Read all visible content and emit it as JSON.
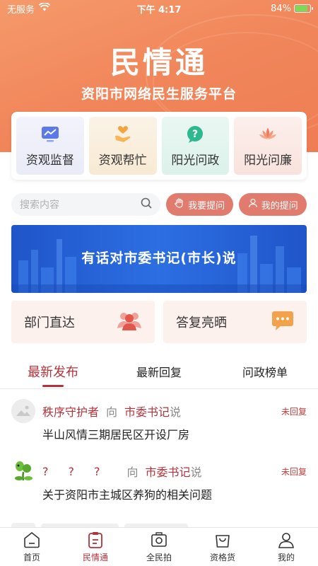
{
  "status_bar": {
    "carrier": "无服务",
    "time": "下午 4:17",
    "battery": "84%",
    "battery_level": 0.84
  },
  "header": {
    "title": "民情通",
    "subtitle": "资阳市网络民生服务平台"
  },
  "quick_entries": [
    {
      "label": "资观监督",
      "icon": "monitor-chart-icon"
    },
    {
      "label": "资观帮忙",
      "icon": "heart-hand-icon"
    },
    {
      "label": "阳光问政",
      "icon": "question-bubble-icon"
    },
    {
      "label": "阳光问廉",
      "icon": "lotus-icon"
    }
  ],
  "search": {
    "placeholder": "搜索内容",
    "ask_button": "我要提问",
    "my_questions_button": "我的提问"
  },
  "banner": {
    "text": "有话对市委书记(市长)说"
  },
  "entries": {
    "department": "部门直达",
    "replies": "答复亮晒"
  },
  "tabs": [
    {
      "label": "最新发布",
      "active": true
    },
    {
      "label": "最新回复",
      "active": false
    },
    {
      "label": "问政榜单",
      "active": false
    }
  ],
  "posts": [
    {
      "user": "秩序守护者",
      "to": "向",
      "target": "市委书记",
      "say": "说",
      "status": "未回复",
      "title": "半山风情三期居民区开设厂房"
    },
    {
      "user": "???",
      "to": "向",
      "target": "市委书记",
      "say": "说",
      "status": "未回复",
      "title": "关于资阳市主城区养狗的相关问题"
    }
  ],
  "bottom_nav": [
    {
      "label": "首页",
      "icon": "home-icon",
      "active": false
    },
    {
      "label": "民情通",
      "icon": "clipboard-icon",
      "active": true
    },
    {
      "label": "全民拍",
      "icon": "camera-icon",
      "active": false
    },
    {
      "label": "资格货",
      "icon": "shopping-bag-icon",
      "active": false
    },
    {
      "label": "我的",
      "icon": "user-icon",
      "active": false
    }
  ],
  "colors": {
    "hero_orange": "#f1865b",
    "accent_red": "#b5323a",
    "pill_button": "#e07b6e",
    "banner_blue": "#2c6fe3"
  }
}
